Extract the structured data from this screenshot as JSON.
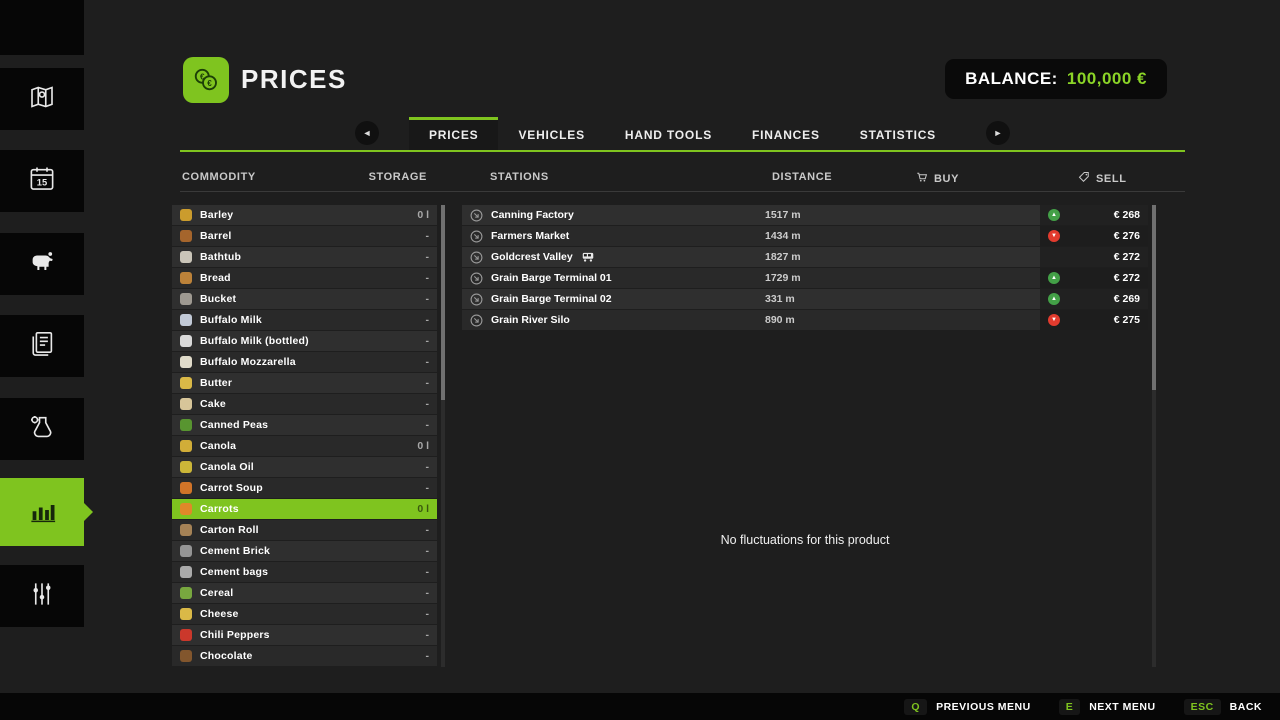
{
  "colors": {
    "accent": "#7fc41f",
    "balance_green": "#8bd427",
    "trend_up": "#43a047",
    "trend_down": "#e23b2e"
  },
  "header": {
    "title": "PRICES",
    "balance_label": "BALANCE:",
    "balance_value": "100,000 €"
  },
  "tabs": [
    {
      "label": "PRICES",
      "active": true
    },
    {
      "label": "VEHICLES",
      "active": false
    },
    {
      "label": "HAND TOOLS",
      "active": false
    },
    {
      "label": "FINANCES",
      "active": false
    },
    {
      "label": "STATISTICS",
      "active": false
    }
  ],
  "columns": {
    "commodity": "COMMODITY",
    "storage": "STORAGE",
    "stations": "STATIONS",
    "distance": "DISTANCE",
    "buy": "BUY",
    "sell": "SELL"
  },
  "sidebar": {
    "items": [
      {
        "name": "map"
      },
      {
        "name": "calendar"
      },
      {
        "name": "animals"
      },
      {
        "name": "contracts"
      },
      {
        "name": "production"
      },
      {
        "name": "statistics",
        "active": true
      },
      {
        "name": "settings"
      }
    ]
  },
  "commodities": [
    {
      "name": "Barley",
      "storage": "0 l",
      "icon": "barley",
      "icon_color": "#d9a62e"
    },
    {
      "name": "Barrel",
      "storage": "-",
      "icon": "barrel",
      "icon_color": "#b06a2c"
    },
    {
      "name": "Bathtub",
      "storage": "-",
      "icon": "bathtub",
      "icon_color": "#d8d2c6"
    },
    {
      "name": "Bread",
      "storage": "-",
      "icon": "bread",
      "icon_color": "#c98a3b"
    },
    {
      "name": "Bucket",
      "storage": "-",
      "icon": "bucket",
      "icon_color": "#a8a39a"
    },
    {
      "name": "Buffalo Milk",
      "storage": "-",
      "icon": "buffalo-milk",
      "icon_color": "#cfd8e6"
    },
    {
      "name": "Buffalo Milk (bottled)",
      "storage": "-",
      "icon": "buffalo-milk-bottled",
      "icon_color": "#e8e8e8"
    },
    {
      "name": "Buffalo Mozzarella",
      "storage": "-",
      "icon": "buffalo-mozzarella",
      "icon_color": "#f0ead8"
    },
    {
      "name": "Butter",
      "storage": "-",
      "icon": "butter",
      "icon_color": "#e9c64a"
    },
    {
      "name": "Cake",
      "storage": "-",
      "icon": "cake",
      "icon_color": "#e6d3a3"
    },
    {
      "name": "Canned Peas",
      "storage": "-",
      "icon": "canned-peas",
      "icon_color": "#5c9e31"
    },
    {
      "name": "Canola",
      "storage": "0 l",
      "icon": "canola",
      "icon_color": "#e0b83a"
    },
    {
      "name": "Canola Oil",
      "storage": "-",
      "icon": "canola-oil",
      "icon_color": "#d9c23a"
    },
    {
      "name": "Carrot Soup",
      "storage": "-",
      "icon": "carrot-soup",
      "icon_color": "#e07b28"
    },
    {
      "name": "Carrots",
      "storage": "0 l",
      "icon": "carrots",
      "icon_color": "#e8822a"
    },
    {
      "name": "Carton Roll",
      "storage": "-",
      "icon": "carton-roll",
      "icon_color": "#b08a5a"
    },
    {
      "name": "Cement Brick",
      "storage": "-",
      "icon": "cement-brick",
      "icon_color": "#9e9e9e"
    },
    {
      "name": "Cement bags",
      "storage": "-",
      "icon": "cement-bags",
      "icon_color": "#b5b5b5"
    },
    {
      "name": "Cereal",
      "storage": "-",
      "icon": "cereal",
      "icon_color": "#7fb241"
    },
    {
      "name": "Cheese",
      "storage": "-",
      "icon": "cheese",
      "icon_color": "#e9c64a"
    },
    {
      "name": "Chili Peppers",
      "storage": "-",
      "icon": "chili-peppers",
      "icon_color": "#d93a2b"
    },
    {
      "name": "Chocolate",
      "storage": "-",
      "icon": "chocolate",
      "icon_color": "#8a5a2e"
    }
  ],
  "selected_commodity": "Carrots",
  "stations": [
    {
      "name": "Canning Factory",
      "distance": "1517 m",
      "price": "€ 268",
      "trend": "up",
      "train": false
    },
    {
      "name": "Farmers Market",
      "distance": "1434 m",
      "price": "€ 276",
      "trend": "down",
      "train": false
    },
    {
      "name": "Goldcrest Valley",
      "distance": "1827 m",
      "price": "€ 272",
      "trend": "none",
      "train": true
    },
    {
      "name": "Grain Barge Terminal 01",
      "distance": "1729 m",
      "price": "€ 272",
      "trend": "up",
      "train": false
    },
    {
      "name": "Grain Barge Terminal 02",
      "distance": "331 m",
      "price": "€ 269",
      "trend": "up",
      "train": false
    },
    {
      "name": "Grain River Silo",
      "distance": "890 m",
      "price": "€ 275",
      "trend": "down",
      "train": false
    }
  ],
  "stations_message": "No fluctuations for this product",
  "footer": {
    "items": [
      {
        "key": "Q",
        "label": "PREVIOUS MENU"
      },
      {
        "key": "E",
        "label": "NEXT MENU"
      },
      {
        "key": "ESC",
        "label": "BACK"
      }
    ]
  }
}
